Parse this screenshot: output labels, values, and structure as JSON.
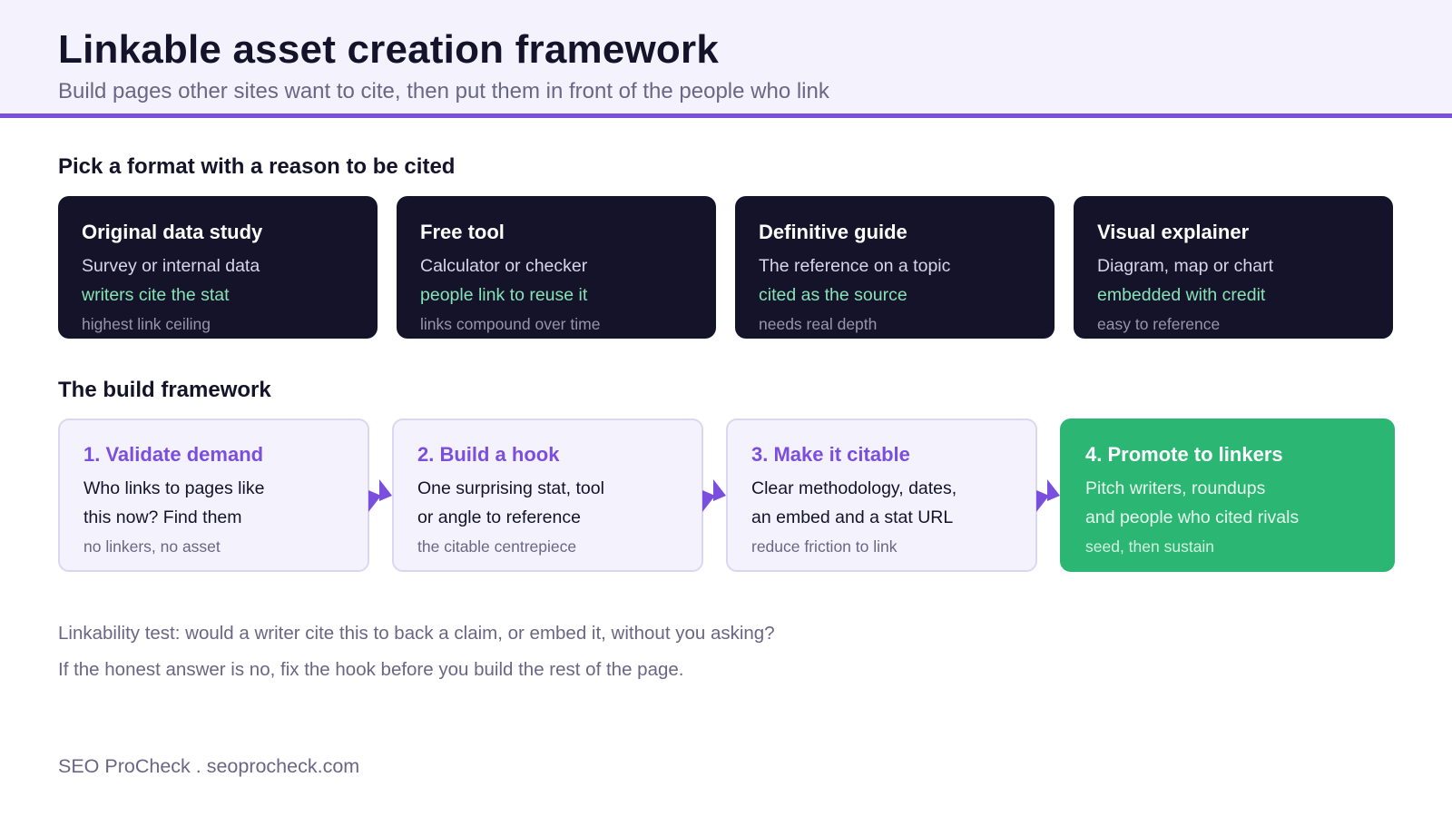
{
  "header": {
    "title": "Linkable asset creation framework",
    "subtitle": "Build pages other sites want to cite, then put them in front of the people who link"
  },
  "formats": {
    "heading": "Pick a format with a reason to be cited",
    "cards": [
      {
        "title": "Original data study",
        "desc": "Survey or internal data",
        "benefit": "writers cite the stat",
        "note": "highest link ceiling"
      },
      {
        "title": "Free tool",
        "desc": "Calculator or checker",
        "benefit": "people link to reuse it",
        "note": "links compound over time"
      },
      {
        "title": "Definitive guide",
        "desc": "The reference on a topic",
        "benefit": "cited as the source",
        "note": "needs real depth"
      },
      {
        "title": "Visual explainer",
        "desc": "Diagram, map or chart",
        "benefit": "embedded with credit",
        "note": "easy to reference"
      }
    ]
  },
  "framework": {
    "heading": "The build framework",
    "steps": [
      {
        "title": "1. Validate demand",
        "line1": "Who links to pages like",
        "line2": "this now? Find them",
        "note": "no linkers, no asset"
      },
      {
        "title": "2. Build a hook",
        "line1": "One surprising stat, tool",
        "line2": "or angle to reference",
        "note": "the citable centrepiece"
      },
      {
        "title": "3. Make it citable",
        "line1": "Clear methodology, dates,",
        "line2": "an embed and a stat URL",
        "note": "reduce friction to link"
      },
      {
        "title": "4. Promote to linkers",
        "line1": "Pitch writers, roundups",
        "line2": "and people who cited rivals",
        "note": "seed, then sustain"
      }
    ]
  },
  "footnotes": {
    "line1": "Linkability test: would a writer cite this to back a claim, or embed it, without you asking?",
    "line2": "If the honest answer is no, fix the hook before you build the rest of the page."
  },
  "footer": {
    "brand": "SEO ProCheck . seoprocheck.com"
  },
  "colors": {
    "accent": "#7b4fde",
    "dark_card": "#15132a",
    "highlight_green": "#86e2b4",
    "final_step": "#2bb673"
  }
}
